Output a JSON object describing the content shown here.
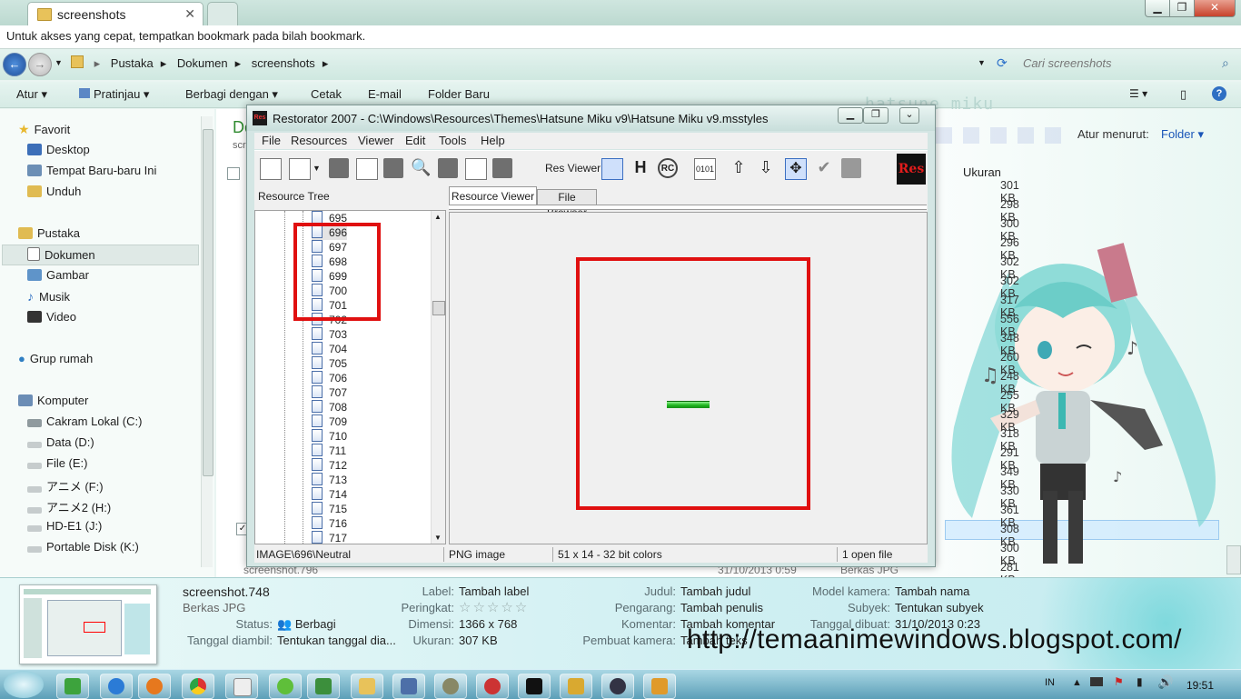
{
  "browser_tab": {
    "title": "screenshots"
  },
  "bookmark_hint": "Untuk akses yang cepat, tempatkan bookmark pada bilah bookmark.",
  "breadcrumb": [
    "Pustaka",
    "Dokumen",
    "screenshots"
  ],
  "search_placeholder": "Cari screenshots",
  "toolbar": {
    "organize": "Atur",
    "preview": "Pratinjau",
    "share": "Berbagi dengan",
    "print": "Cetak",
    "email": "E-mail",
    "new_folder": "Folder Baru"
  },
  "watermark": "hatsune miku",
  "sort_label": "Atur menurut:",
  "sort_value": "Folder",
  "column_size": "Ukuran",
  "sizes": [
    "301 KB",
    "298 KB",
    "300 KB",
    "296 KB",
    "302 KB",
    "302 KB",
    "317 KB",
    "556 KB",
    "348 KB",
    "260 KB",
    "248 KB",
    "255 KB",
    "329 KB",
    "318 KB",
    "291 KB",
    "349 KB",
    "330 KB",
    "361 KB",
    "308 KB",
    "300 KB",
    "281 KB"
  ],
  "nav": {
    "favorites": "Favorit",
    "desktop": "Desktop",
    "recent": "Tempat Baru-baru Ini",
    "downloads": "Unduh",
    "libraries": "Pustaka",
    "documents": "Dokumen",
    "pictures": "Gambar",
    "music": "Musik",
    "video": "Video",
    "homegroup": "Grup rumah",
    "computer": "Komputer",
    "drive_c": "Cakram Lokal (C:)",
    "drive_d": "Data (D:)",
    "drive_e": "File (E:)",
    "drive_f": "アニメ (F:)",
    "drive_h": "アニメ2 (H:)",
    "drive_j": "HD-E1 (J:)",
    "drive_k": "Portable Disk (K:)"
  },
  "restorator": {
    "title": "Restorator 2007 - C:\\Windows\\Resources\\Themes\\Hatsune Miku v9\\Hatsune Miku v9.msstyles",
    "menu": [
      "File",
      "Resources",
      "Viewer",
      "Edit",
      "Tools",
      "Help"
    ],
    "res_viewer_label": "Res Viewer:",
    "logo": "Res",
    "tree_label": "Resource Tree",
    "tab_viewer": "Resource Viewer",
    "tab_browser": "File Browser",
    "tree_items": [
      "695",
      "696",
      "697",
      "698",
      "699",
      "700",
      "701",
      "702",
      "703",
      "704",
      "705",
      "706",
      "707",
      "708",
      "709",
      "710",
      "711",
      "712",
      "713",
      "714",
      "715",
      "716",
      "717"
    ],
    "status_path": "IMAGE\\696\\Neutral",
    "status_type": "PNG image",
    "status_dims": "51 x 14 - 32 bit colors",
    "status_files": "1 open file"
  },
  "details": {
    "filename": "screenshot.748",
    "filetype": "Berkas JPG",
    "status_label": "Status:",
    "status_value": "Berbagi",
    "date_taken_label": "Tanggal diambil:",
    "date_taken_value": "Tentukan tanggal dia...",
    "tag_label": "Label:",
    "tag_value": "Tambah label",
    "rating_label": "Peringkat:",
    "dimension_label": "Dimensi:",
    "dimension_value": "1366 x 768",
    "size_label": "Ukuran:",
    "size_value": "307 KB",
    "title_label": "Judul:",
    "title_value": "Tambah judul",
    "author_label": "Pengarang:",
    "author_value": "Tambah penulis",
    "comment_label": "Komentar:",
    "comment_value": "Tambah komentar",
    "maker_label": "Pembuat kamera:",
    "maker_value": "Tambah teks",
    "model_label": "Model kamera:",
    "model_value": "Tambah nama",
    "subject_label": "Subyek:",
    "subject_value": "Tentukan subyek",
    "created_label": "Tanggal dibuat:",
    "created_value": "31/10/2013 0:23",
    "behind_row": "screenshot.796",
    "behind_date": "31/10/2013 0:59",
    "behind_type": "Berkas JPG"
  },
  "blog_url": "http://temaanimewindows.blogspot.com/",
  "taskbar": {
    "lang": "IN",
    "time": "19:51"
  },
  "colors": {
    "highlight_red": "#e01010",
    "accent_teal": "#5fd0d8"
  }
}
